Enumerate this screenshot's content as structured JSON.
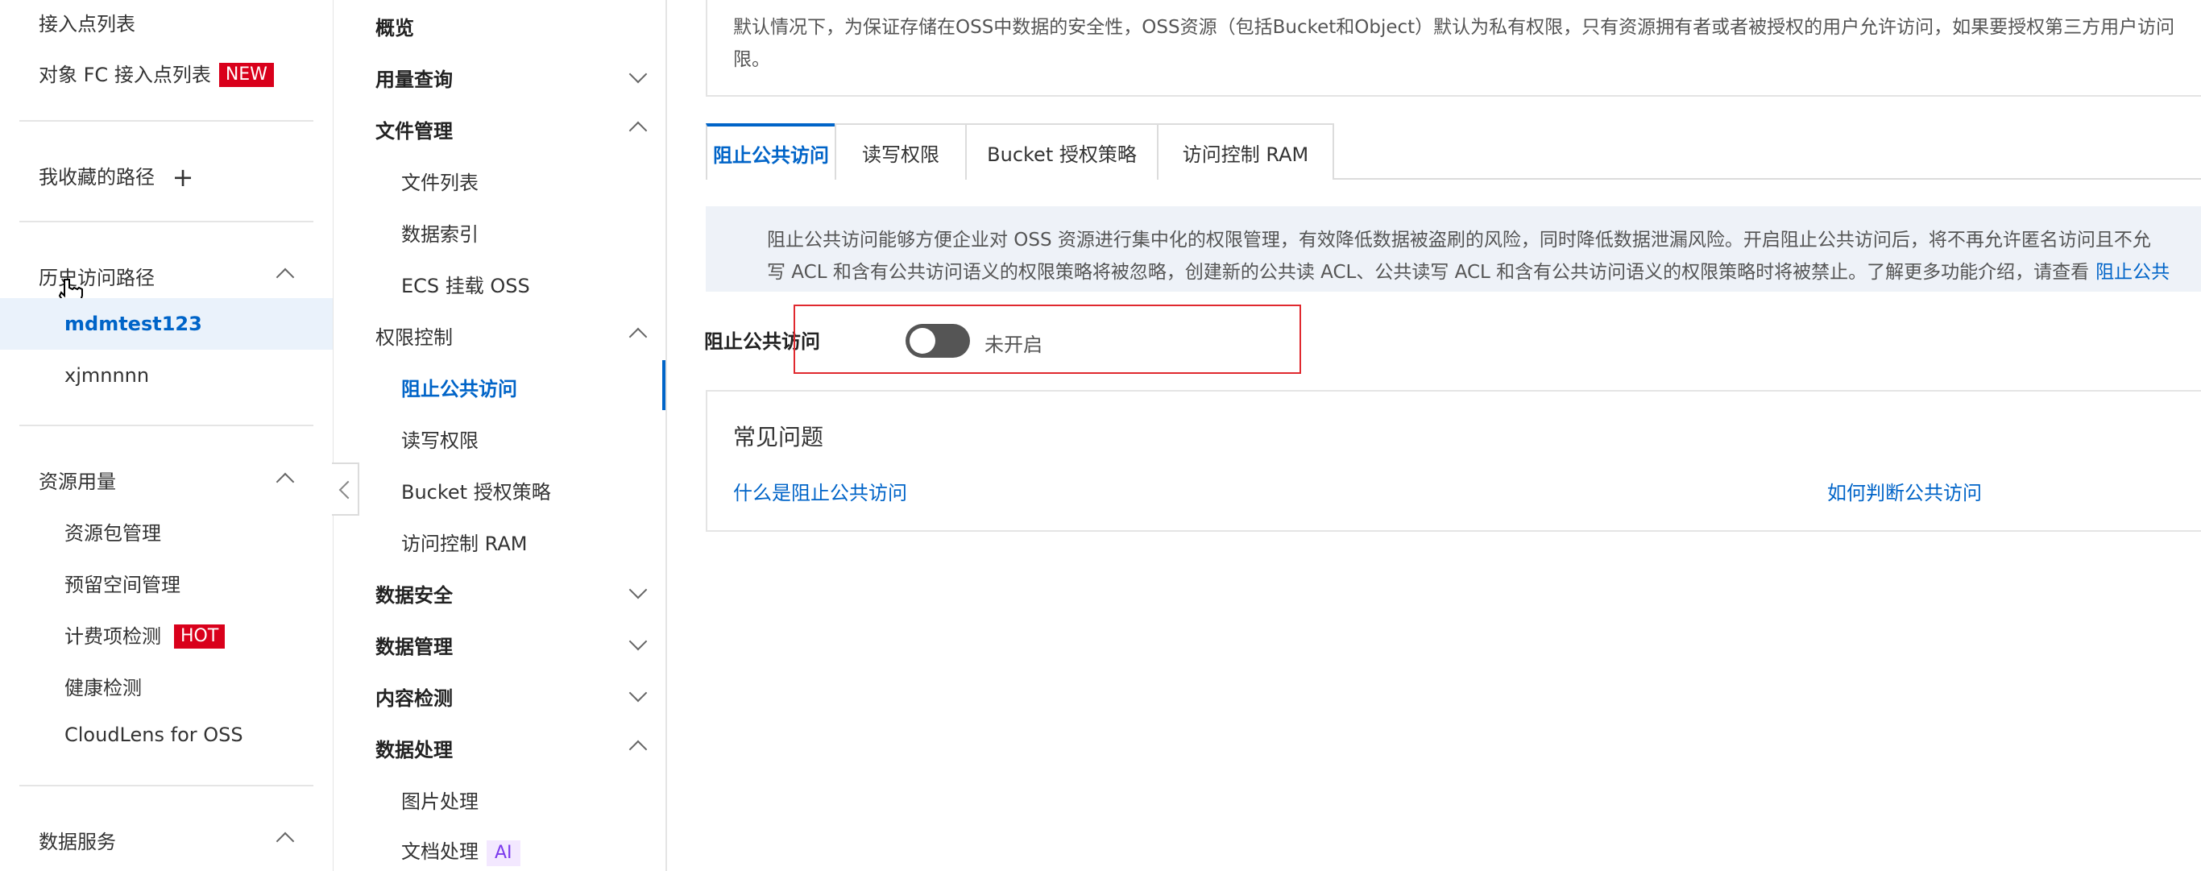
{
  "sidebar": {
    "access_point_list": "接入点列表",
    "fc_access_point_list": "对象 FC 接入点列表",
    "fc_badge": "NEW",
    "favorite_paths": "我收藏的路径",
    "favorite_add": "+",
    "history_paths": "历史访问路径",
    "history_items": [
      "mdmtest123",
      "xjmnnnn"
    ],
    "resource_usage": "资源用量",
    "resource_items": [
      "资源包管理",
      "预留空间管理",
      "计费项检测",
      "健康检测",
      "CloudLens for OSS"
    ],
    "billing_badge": "HOT",
    "data_service": "数据服务"
  },
  "menu2": {
    "overview": "概览",
    "usage_query": "用量查询",
    "file_mgmt": "文件管理",
    "file_items": [
      "文件列表",
      "数据索引",
      "ECS 挂载 OSS"
    ],
    "permission_control": "权限控制",
    "permission_items": [
      "阻止公共访问",
      "读写权限",
      "Bucket 授权策略",
      "访问控制 RAM"
    ],
    "data_security": "数据安全",
    "data_mgmt": "数据管理",
    "content_check": "内容检测",
    "data_processing": "数据处理",
    "processing_items": [
      "图片处理",
      "文档处理"
    ],
    "ai_badge": "AI"
  },
  "content": {
    "notice_line1": "默认情况下，为保证存储在OSS中数据的安全性，OSS资源（包括Bucket和Object）默认为私有权限，只有资源拥有者或者被授权的用户允许访问，如果要授权第三方用户访问",
    "notice_line2": "限。",
    "tabs": [
      "阻止公共访问",
      "读写权限",
      "Bucket 授权策略",
      "访问控制 RAM"
    ],
    "info_line1": "阻止公共访问能够方便企业对 OSS 资源进行集中化的权限管理，有效降低数据被盗刷的风险，同时降低数据泄漏风险。开启阻止公共访问后，将不再允许匿名访问且不允",
    "info_line2": "写 ACL 和含有公共访问语义的权限策略将被忽略，创建新的公共读 ACL、公共读写 ACL 和含有公共访问语义的权限策略时将被禁止。了解更多功能介绍，请查看",
    "info_link": "阻止公共",
    "toggle_label": "阻止公共访问",
    "toggle_status": "未开启",
    "faq_title": "常见问题",
    "faq_links": [
      "什么是阻止公共访问",
      "如何判断公共访问"
    ]
  },
  "colors": {
    "accent": "#0064c8",
    "badge_red": "#d9001b",
    "highlight_border": "#e0292f",
    "info_bg": "#eef2f8",
    "active_bg": "#eaf2fb"
  }
}
